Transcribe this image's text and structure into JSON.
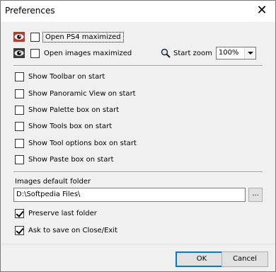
{
  "window": {
    "title": "Preferences",
    "close_glyph": "✕"
  },
  "options": {
    "open_ps4": {
      "label": "Open PS4 maximized",
      "checked": false,
      "icon": "eye-icon"
    },
    "open_images": {
      "label": "Open images maximized",
      "checked": false,
      "icon": "eye-icon"
    }
  },
  "zoom": {
    "label": "Start zoom",
    "value": "100%",
    "icon": "magnifier-icon"
  },
  "start_options": [
    {
      "label": "Show Toolbar on start",
      "checked": false
    },
    {
      "label": "Show Panoramic View on start",
      "checked": false
    },
    {
      "label": "Show Palette box on start",
      "checked": false
    },
    {
      "label": "Show Tools box on start",
      "checked": false
    },
    {
      "label": "Show Tool options box on start",
      "checked": false
    },
    {
      "label": "Show Paste box on start",
      "checked": false
    }
  ],
  "folder": {
    "label": "Images default folder",
    "value": "D:\\Softpedia Files\\",
    "browse_label": "..."
  },
  "folder_options": [
    {
      "label": "Preserve last folder",
      "checked": true
    },
    {
      "label": "Ask to save on Close/Exit",
      "checked": true
    }
  ],
  "buttons": {
    "ok": "OK",
    "cancel": "Cancel"
  },
  "colors": {
    "eye_red": "#c0392b",
    "focus_blue": "#0078d7"
  }
}
